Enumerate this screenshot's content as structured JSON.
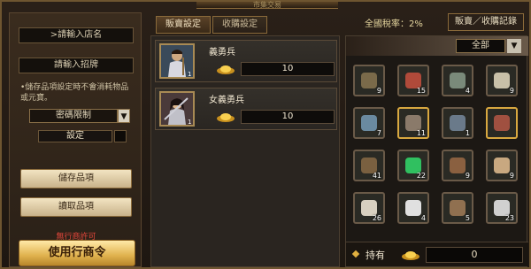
{
  "window": {
    "title": "市集交易"
  },
  "left_panel": {
    "shop_name_placeholder": ">請輸入店名",
    "sign_placeholder": "請輸入招牌",
    "note": "•儲存品項設定時不會消耗物品或元寶。",
    "password_limit": "密碼限制",
    "setting": "設定",
    "save_items": "儲存品項",
    "load_items": "讀取品項",
    "no_permit": "無行商許可",
    "use_merchant": "使用行商令"
  },
  "tabs": [
    {
      "label": "販賣設定",
      "active": true
    },
    {
      "label": "收購設定",
      "active": false
    }
  ],
  "tax": {
    "label": "全國稅率：2%"
  },
  "record_button": "販賣／收購記錄",
  "units": [
    {
      "name": "義勇兵",
      "level": "1",
      "price": "10"
    },
    {
      "name": "女義勇兵",
      "level": "1",
      "price": "10"
    }
  ],
  "inventory": {
    "filter": "全部",
    "slots": [
      {
        "icon": "bow-icon",
        "count": "9",
        "highlight": false,
        "color": "#7a6a4a"
      },
      {
        "icon": "cloth-icon",
        "count": "15",
        "highlight": false,
        "color": "#b04a3a"
      },
      {
        "icon": "orb-icon",
        "count": "4",
        "highlight": false,
        "color": "#7a8a7a"
      },
      {
        "icon": "bone-icon",
        "count": "9",
        "highlight": false,
        "color": "#c8c0a8"
      },
      {
        "icon": "bucket-icon",
        "count": "7",
        "highlight": false,
        "color": "#6a8aa0"
      },
      {
        "icon": "soldier-icon",
        "count": "11",
        "highlight": true,
        "color": "#8a7a6a"
      },
      {
        "icon": "pot-icon",
        "count": "1",
        "highlight": false,
        "color": "#6a7a8a"
      },
      {
        "icon": "swordsman-icon",
        "count": "",
        "highlight": true,
        "color": "#a05040"
      },
      {
        "icon": "box-icon",
        "count": "41",
        "highlight": false,
        "color": "#7a6040"
      },
      {
        "icon": "jade-icon",
        "count": "22",
        "highlight": false,
        "color": "#30c060"
      },
      {
        "icon": "stick-icon",
        "count": "9",
        "highlight": false,
        "color": "#8a6040"
      },
      {
        "icon": "scroll-icon",
        "count": "9",
        "highlight": false,
        "color": "#c8a880"
      },
      {
        "icon": "dice-icon",
        "count": "26",
        "highlight": false,
        "color": "#d8d0c0"
      },
      {
        "icon": "silk-icon",
        "count": "4",
        "highlight": false,
        "color": "#e0e0e0"
      },
      {
        "icon": "spear-icon",
        "count": "5",
        "highlight": false,
        "color": "#907050"
      },
      {
        "icon": "ore-icon",
        "count": "23",
        "highlight": false,
        "color": "#d0d0d0"
      }
    ]
  },
  "holding": {
    "label": "持有",
    "value": "0"
  }
}
